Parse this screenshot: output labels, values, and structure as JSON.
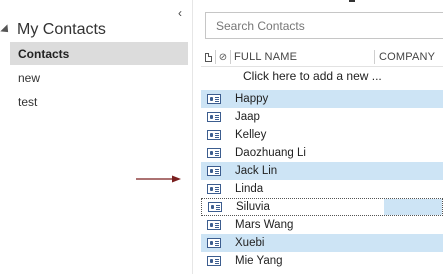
{
  "folder_pane": {
    "collapse_glyph": "‹",
    "group_title": "My Contacts",
    "items": [
      {
        "label": "Contacts",
        "selected": true
      },
      {
        "label": "new",
        "selected": false
      },
      {
        "label": "test",
        "selected": false
      }
    ]
  },
  "search": {
    "placeholder": "Search Contacts"
  },
  "list": {
    "columns": {
      "full_name": "FULL NAME",
      "company": "COMPANY"
    },
    "add_new": "Click here to add a new ...",
    "contacts": [
      {
        "name": "Happy",
        "state": "highlighted"
      },
      {
        "name": "Jaap",
        "state": "normal"
      },
      {
        "name": "Kelley",
        "state": "normal"
      },
      {
        "name": "Daozhuang Li",
        "state": "normal"
      },
      {
        "name": "Jack Lin",
        "state": "highlighted"
      },
      {
        "name": "Linda",
        "state": "normal"
      },
      {
        "name": "Siluvia",
        "state": "focused"
      },
      {
        "name": "Mars Wang",
        "state": "normal"
      },
      {
        "name": "Xuebi",
        "state": "highlighted"
      },
      {
        "name": "Mie Yang",
        "state": "normal"
      }
    ]
  },
  "colors": {
    "highlight": "#cde4f5",
    "selected_folder": "#dcdcdc",
    "annotation_arrow": "#7a1f1f",
    "card_icon": "#3c5d8f"
  },
  "icons": {
    "collapse": "chevron-left-icon",
    "group_caret": "caret-expanded-icon",
    "header_doc": "document-icon",
    "header_attachment": "paperclip-icon",
    "contact_row": "contact-card-icon"
  }
}
